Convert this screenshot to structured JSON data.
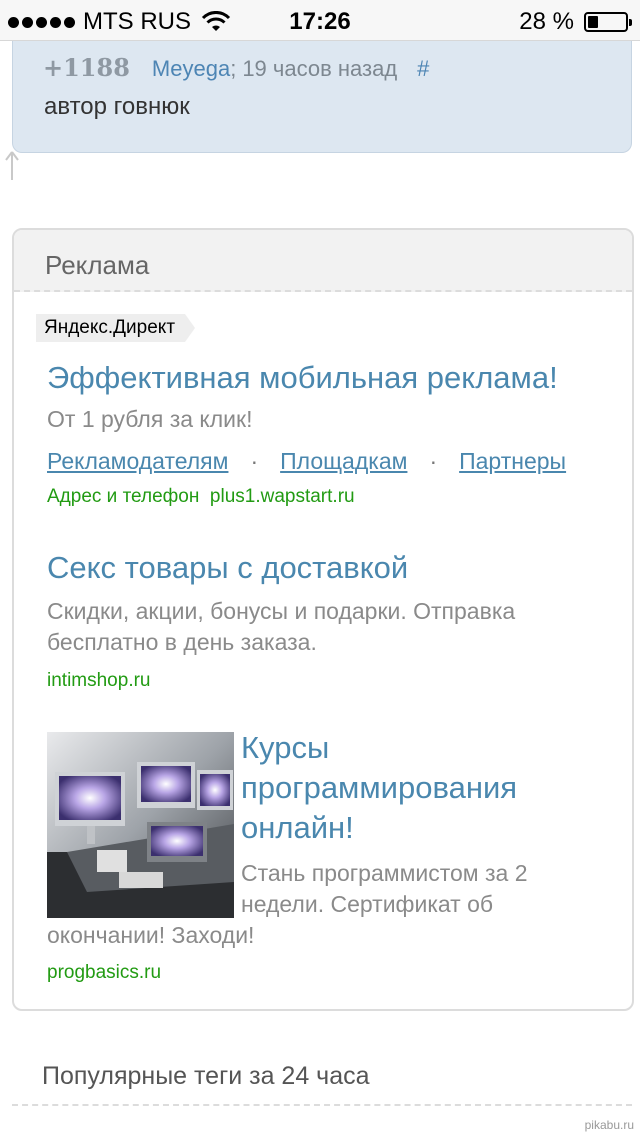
{
  "status_bar": {
    "carrier": "MTS RUS",
    "time": "17:26",
    "battery_text": "28 %",
    "battery_level": 0.28
  },
  "comment": {
    "rating": "+1188",
    "author": "Meyega",
    "separator": ";",
    "time_ago": "19 часов назад",
    "anchor": "#",
    "text": "автор говнюк"
  },
  "ads_section": {
    "title": "Реклама",
    "provider_badge": "Яндекс.Директ",
    "ads": [
      {
        "title": "Эффективная мобильная реклама!",
        "description": "От 1 рубля за клик!",
        "links": [
          "Рекламодателям",
          "Площадкам",
          "Партнеры"
        ],
        "link_separator": "·",
        "contact_label": "Адрес и телефон",
        "url": "plus1.wapstart.ru"
      },
      {
        "title": "Секс товары с доставкой",
        "description_line1": "Скидки, акции, бонусы и подарки. Отправка",
        "description_line2": "бесплатно в день заказа.",
        "url": "intimshop.ru"
      },
      {
        "title_line1": "Курсы",
        "title_line2": "программирования",
        "title_line3": "онлайн!",
        "description_line1": "Стань программистом за 2",
        "description_line2": "недели. Сертификат об",
        "description_line3": "окончании! Заходи!",
        "url": "progbasics.ru"
      }
    ]
  },
  "popular_tags": {
    "title": "Популярные теги за 24 часа"
  },
  "watermark": "pikabu.ru"
}
